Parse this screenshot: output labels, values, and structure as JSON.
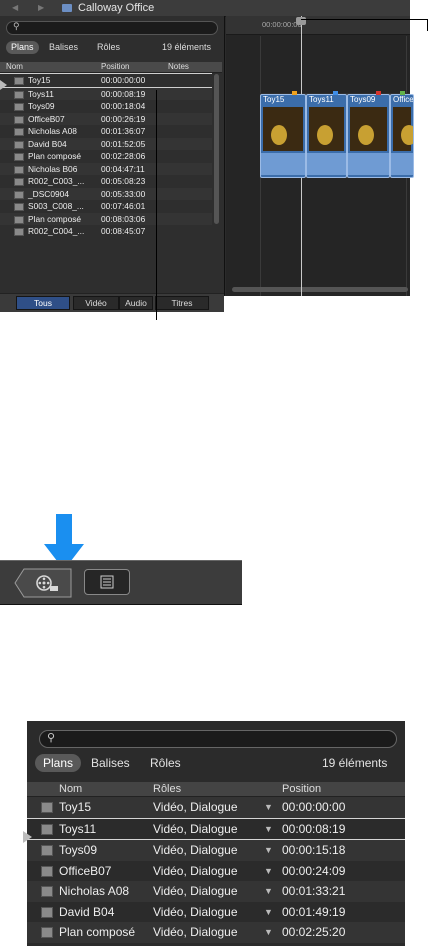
{
  "top_browser": {
    "window_title": "Calloway Office",
    "filters": [
      "Plans",
      "Balises",
      "Rôles"
    ],
    "count": "19 éléments",
    "columns": [
      "Nom",
      "Position",
      "Notes"
    ],
    "rows": [
      {
        "name": "Toy15",
        "position": "00:00:00:00"
      },
      {
        "name": "Toys11",
        "position": "00:00:08:19"
      },
      {
        "name": "Toys09",
        "position": "00:00:18:04"
      },
      {
        "name": "OfficeB07",
        "position": "00:00:26:19"
      },
      {
        "name": "Nicholas A08",
        "position": "00:01:36:07"
      },
      {
        "name": "David B04",
        "position": "00:01:52:05"
      },
      {
        "name": "Plan composé",
        "position": "00:02:28:06"
      },
      {
        "name": "Nicholas B06",
        "position": "00:04:47:11"
      },
      {
        "name": "R002_C003_...",
        "position": "00:05:08:23"
      },
      {
        "name": "_DSC0904",
        "position": "00:05:33:00"
      },
      {
        "name": "S003_C008_...",
        "position": "00:07:46:01"
      },
      {
        "name": "Plan composé",
        "position": "00:08:03:06"
      },
      {
        "name": "R002_C004_...",
        "position": "00:08:45:07"
      }
    ],
    "bottom_buttons": [
      "Tous",
      "Vidéo",
      "Audio",
      "Titres"
    ]
  },
  "timeline": {
    "timecode": "00:00:00:00",
    "clips": [
      {
        "name": "Toy15",
        "marker_color": "#f0a21e"
      },
      {
        "name": "Toys11",
        "marker_color": "#3f8ee8"
      },
      {
        "name": "Toys09",
        "marker_color": "#d8342c"
      },
      {
        "name": "OfficeB",
        "marker_color": "#62b24a"
      }
    ]
  },
  "toolbar": {
    "film_icon": "film-reel-icon",
    "list_icon": "list-icon",
    "arrow_color": "#1a8ff0"
  },
  "bottom_browser": {
    "filters": [
      "Plans",
      "Balises",
      "Rôles"
    ],
    "count": "19 éléments",
    "columns": [
      "Nom",
      "Rôles",
      "Position"
    ],
    "rows": [
      {
        "name": "Toy15",
        "roles": "Vidéo, Dialogue",
        "position": "00:00:00:00"
      },
      {
        "name": "Toys11",
        "roles": "Vidéo, Dialogue",
        "position": "00:00:08:19"
      },
      {
        "name": "Toys09",
        "roles": "Vidéo, Dialogue",
        "position": "00:00:15:18"
      },
      {
        "name": "OfficeB07",
        "roles": "Vidéo, Dialogue",
        "position": "00:00:24:09"
      },
      {
        "name": "Nicholas A08",
        "roles": "Vidéo, Dialogue",
        "position": "00:01:33:21"
      },
      {
        "name": "David B04",
        "roles": "Vidéo, Dialogue",
        "position": "00:01:49:19"
      },
      {
        "name": "Plan composé",
        "roles": "Vidéo, Dialogue",
        "position": "00:02:25:20"
      }
    ]
  }
}
